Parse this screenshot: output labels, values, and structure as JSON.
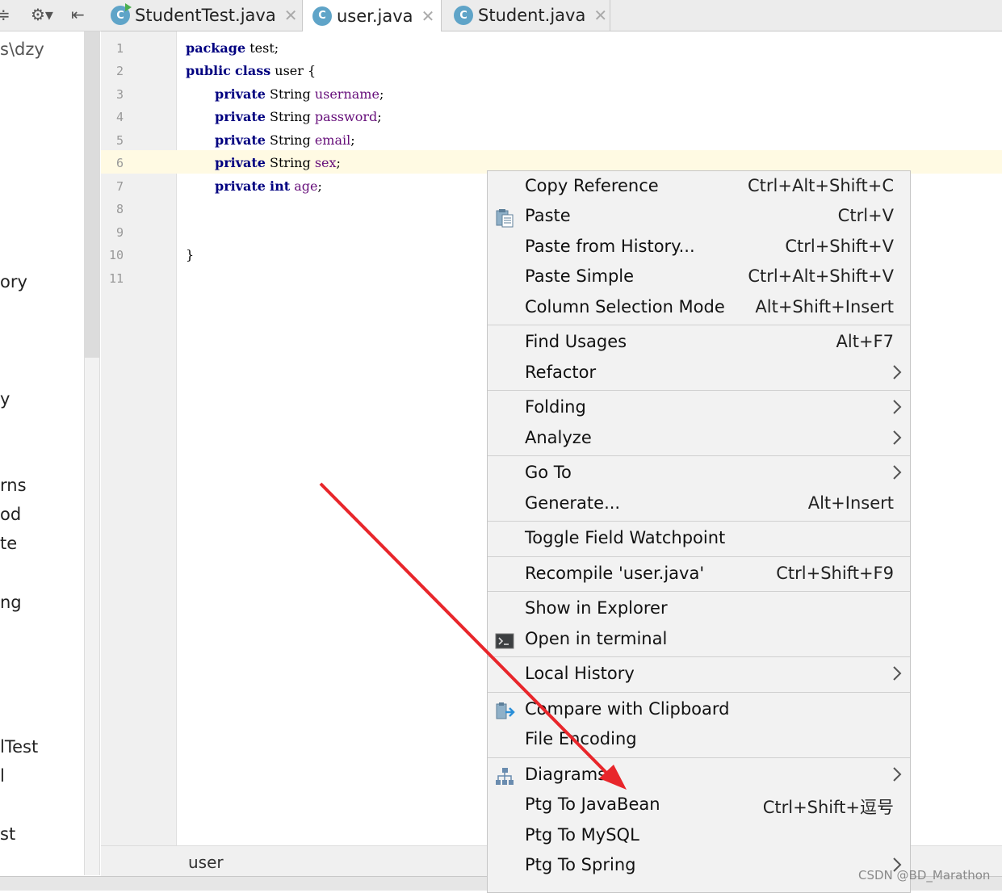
{
  "tabs": [
    {
      "label": "StudentTest.java",
      "icon": "C",
      "active": false
    },
    {
      "label": "user.java",
      "icon": "C",
      "active": true
    },
    {
      "label": "Student.java",
      "icon": "C",
      "active": false
    }
  ],
  "sidebar_fragments": [
    "s\\dzy",
    "ory",
    "y",
    "rns",
    "od",
    "te",
    "ng",
    "lTest",
    "l",
    "st"
  ],
  "line_numbers": [
    "1",
    "2",
    "3",
    "4",
    "5",
    "6",
    "7",
    "8",
    "9",
    "10",
    "11"
  ],
  "code": {
    "l1_kw": "package",
    "l1_rest": " test;",
    "l2_kw1": "public",
    "l2_kw2": "class",
    "l2_rest": " user {",
    "private_kw": "private",
    "string_type": " String ",
    "int_type": "int",
    "f_username": "username",
    "f_password": "password",
    "f_email": "email",
    "f_sex": "sex",
    "f_age": "age",
    "semicolon": ";",
    "close_brace": "}"
  },
  "breadcrumb": "user",
  "menu": {
    "copy_reference": {
      "label": "Copy Reference",
      "shortcut": "Ctrl+Alt+Shift+C"
    },
    "paste": {
      "label": "Paste",
      "shortcut": "Ctrl+V"
    },
    "paste_history": {
      "label": "Paste from History...",
      "shortcut": "Ctrl+Shift+V"
    },
    "paste_simple": {
      "label": "Paste Simple",
      "shortcut": "Ctrl+Alt+Shift+V"
    },
    "column_mode": {
      "label": "Column Selection Mode",
      "shortcut": "Alt+Shift+Insert"
    },
    "find_usages": {
      "label": "Find Usages",
      "shortcut": "Alt+F7"
    },
    "refactor": {
      "label": "Refactor"
    },
    "folding": {
      "label": "Folding"
    },
    "analyze": {
      "label": "Analyze"
    },
    "go_to": {
      "label": "Go To"
    },
    "generate": {
      "label": "Generate...",
      "shortcut": "Alt+Insert"
    },
    "toggle_watch": {
      "label": "Toggle Field Watchpoint"
    },
    "recompile": {
      "label": "Recompile 'user.java'",
      "shortcut": "Ctrl+Shift+F9"
    },
    "show_explorer": {
      "label": "Show in Explorer"
    },
    "open_terminal": {
      "label": "Open in terminal"
    },
    "local_history": {
      "label": "Local History"
    },
    "compare_clipboard": {
      "label": "Compare with Clipboard"
    },
    "file_encoding": {
      "label": "File Encoding"
    },
    "diagrams": {
      "label": "Diagrams"
    },
    "ptg_javabean": {
      "label": "Ptg To JavaBean",
      "shortcut": "Ctrl+Shift+逗号"
    },
    "ptg_mysql": {
      "label": "Ptg To MySQL"
    },
    "ptg_spring": {
      "label": "Ptg To Spring"
    }
  },
  "watermark": "CSDN @BD_Marathon",
  "colors": {
    "keyword": "#000080",
    "field": "#660e7a",
    "annotation_arrow": "#e8262b",
    "line_highlight": "#fffae3"
  }
}
